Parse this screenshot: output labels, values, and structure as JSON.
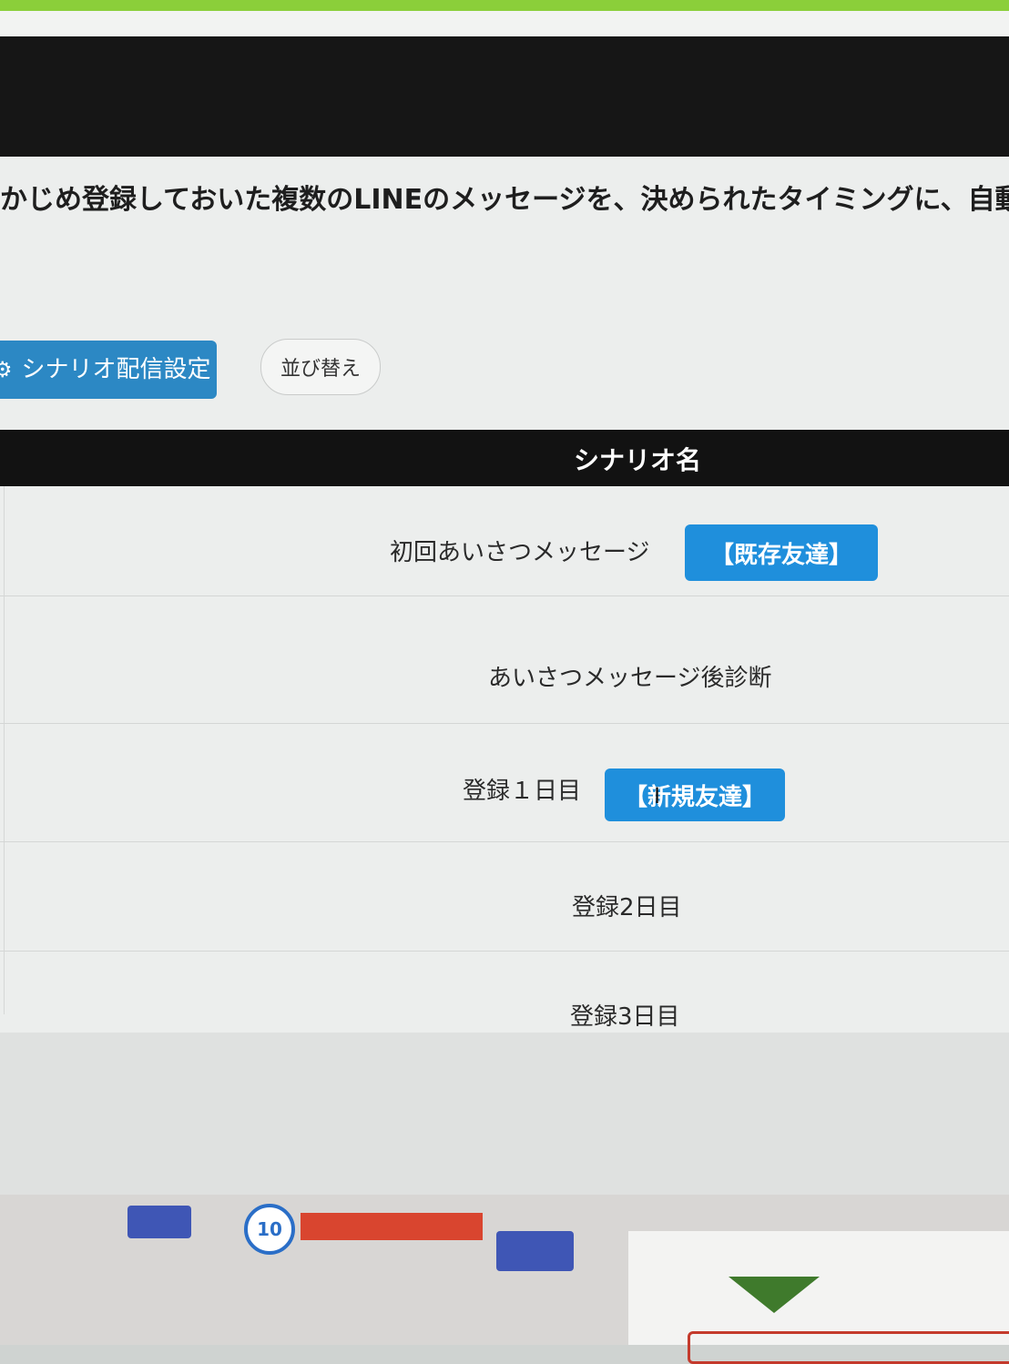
{
  "description": "かじめ登録しておいた複数のLINEのメッセージを、決められたタイミングに、自動で配",
  "toolbar": {
    "settings_label": "シナリオ配信設定",
    "sort_label": "並び替え"
  },
  "table": {
    "header": "シナリオ名",
    "rows": [
      {
        "name": "初回あいさつメッセージ",
        "badge": "【既存友達】"
      },
      {
        "name": "あいさつメッセージ後診断",
        "badge": ""
      },
      {
        "name": "登録１日目",
        "badge": "【新規友達】"
      },
      {
        "name": "登録2日目",
        "badge": ""
      },
      {
        "name": "登録3日目",
        "badge": ""
      }
    ]
  },
  "desk": {
    "thumb_badge": "10"
  },
  "colors": {
    "accent": "#1f8fdc",
    "settings_button": "#2c88c4",
    "header_bar": "#121212"
  },
  "icons": {
    "settings": "gear-icon",
    "cursor": "text-cursor-icon"
  }
}
